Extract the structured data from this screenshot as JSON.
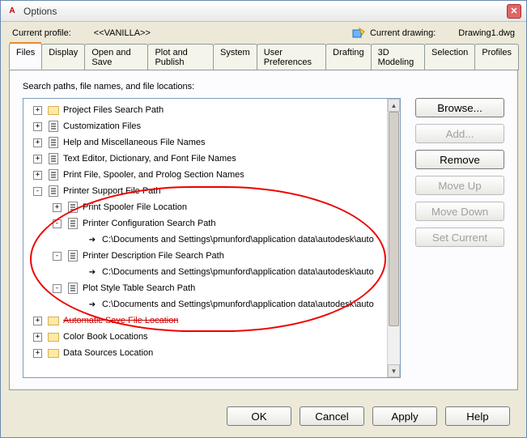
{
  "window": {
    "title": "Options"
  },
  "profile": {
    "label": "Current profile:",
    "value": "<<VANILLA>>",
    "drawing_label": "Current drawing:",
    "drawing_value": "Drawing1.dwg"
  },
  "tabs": [
    {
      "label": "Files",
      "active": true
    },
    {
      "label": "Display"
    },
    {
      "label": "Open and Save"
    },
    {
      "label": "Plot and Publish"
    },
    {
      "label": "System"
    },
    {
      "label": "User Preferences"
    },
    {
      "label": "Drafting"
    },
    {
      "label": "3D Modeling"
    },
    {
      "label": "Selection"
    },
    {
      "label": "Profiles"
    }
  ],
  "panel_title": "Search paths, file names, and file locations:",
  "tree": [
    {
      "lvl": 0,
      "exp": "+",
      "icon": "folder",
      "label": "Project Files Search Path"
    },
    {
      "lvl": 0,
      "exp": "+",
      "icon": "doc",
      "label": "Customization Files"
    },
    {
      "lvl": 0,
      "exp": "+",
      "icon": "doc",
      "label": "Help and Miscellaneous File Names"
    },
    {
      "lvl": 0,
      "exp": "+",
      "icon": "doc",
      "label": "Text Editor, Dictionary, and Font File Names"
    },
    {
      "lvl": 0,
      "exp": "+",
      "icon": "doc",
      "label": "Print File, Spooler, and Prolog Section Names"
    },
    {
      "lvl": 0,
      "exp": "-",
      "icon": "doc",
      "label": "Printer Support File Path"
    },
    {
      "lvl": 1,
      "exp": "+",
      "icon": "doc",
      "label": "Print Spooler File Location"
    },
    {
      "lvl": 1,
      "exp": "-",
      "icon": "doc",
      "label": "Printer Configuration Search Path"
    },
    {
      "lvl": 2,
      "exp": "",
      "icon": "arrow",
      "label": "C:\\Documents and Settings\\pmunford\\application data\\autodesk\\auto"
    },
    {
      "lvl": 1,
      "exp": "-",
      "icon": "doc",
      "label": "Printer Description File Search Path"
    },
    {
      "lvl": 2,
      "exp": "",
      "icon": "arrow",
      "label": "C:\\Documents and Settings\\pmunford\\application data\\autodesk\\auto"
    },
    {
      "lvl": 1,
      "exp": "-",
      "icon": "doc",
      "label": "Plot Style Table Search Path"
    },
    {
      "lvl": 2,
      "exp": "",
      "icon": "arrow",
      "label": "C:\\Documents and Settings\\pmunford\\application data\\autodesk\\auto"
    },
    {
      "lvl": 0,
      "exp": "+",
      "icon": "folder-open",
      "label": "Automatic Save File Location",
      "strike": true
    },
    {
      "lvl": 0,
      "exp": "+",
      "icon": "folder-open",
      "label": "Color Book Locations"
    },
    {
      "lvl": 0,
      "exp": "+",
      "icon": "folder-open",
      "label": "Data Sources Location"
    }
  ],
  "buttons": {
    "browse": "Browse...",
    "add": "Add...",
    "remove": "Remove",
    "moveup": "Move Up",
    "movedown": "Move Down",
    "setcurrent": "Set Current"
  },
  "bottom": {
    "ok": "OK",
    "cancel": "Cancel",
    "apply": "Apply",
    "help": "Help"
  }
}
